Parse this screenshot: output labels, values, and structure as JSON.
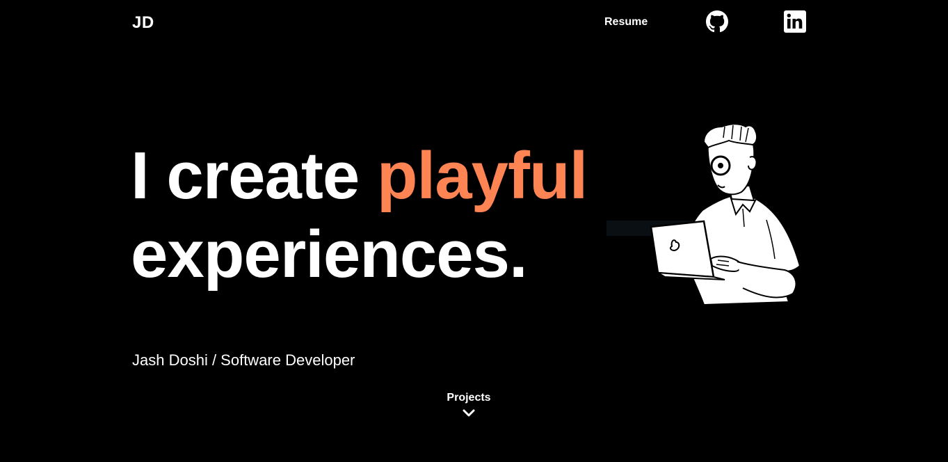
{
  "header": {
    "logo": "JD",
    "nav": {
      "resume_label": "Resume",
      "github_icon": "github-icon",
      "linkedin_icon": "linkedin-icon"
    }
  },
  "hero": {
    "title_part1": "I create ",
    "title_accent": "playful",
    "title_part2": "experiences.",
    "subtitle": "Jash Doshi / Software Developer",
    "illustration": "developer-with-laptop-illustration"
  },
  "projects": {
    "label": "Projects",
    "icon": "chevron-down-icon"
  },
  "colors": {
    "background": "#000000",
    "text": "#ffffff",
    "accent": "#ff8454"
  }
}
